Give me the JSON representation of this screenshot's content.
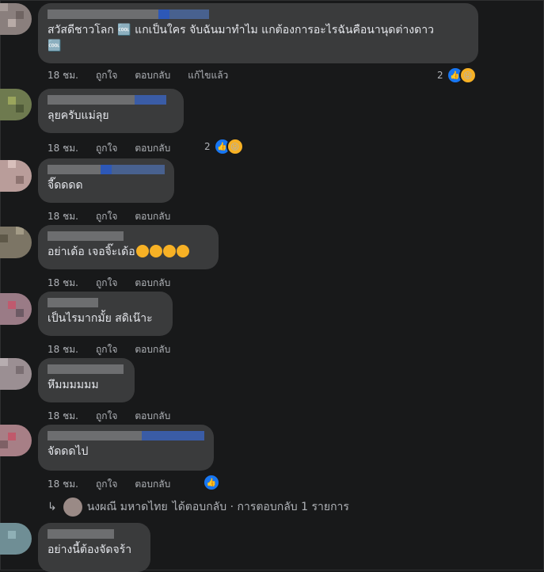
{
  "colors": {
    "background": "#18191a",
    "bubble": "#3a3b3c",
    "text": "#e4e6eb",
    "muted": "#b0b3b8",
    "like": "#1877f2",
    "haha": "#f7b125"
  },
  "actions": {
    "like": "ถูกใจ",
    "reply": "ตอบกลับ",
    "edited": "แก้ไขแล้ว"
  },
  "comments": [
    {
      "text": "สวัสดีชาวโลก 🆒 แกเป็นใคร จับฉันมาทำไม แกต้องการอะไรฉันคือนานุดต่างดาว",
      "text2": "🆒",
      "time": "18 ชม.",
      "reactions": "2"
    },
    {
      "text": "ลุยครับแม่ลุย",
      "time": "18 ชม.",
      "reactions": "2"
    },
    {
      "text": "จี๊ดดดด",
      "time": "18 ชม."
    },
    {
      "text": "อย่าเด้อ เจอจิ๊ะเด้อ",
      "time": "18 ชม."
    },
    {
      "text": "เป็นไรมากมั้ย สดิเน๊าะ",
      "time": "18 ชม."
    },
    {
      "text": "หึมมมมมม",
      "time": "18 ชม."
    },
    {
      "text": "จัดดดไป",
      "time": "18 ชม."
    },
    {
      "text": "อย่างนี้ต้องจัดจร้า"
    }
  ],
  "reply_summary": {
    "author": "นงผณี มหาดไทย",
    "text": "ได้ตอบกลับ · การตอบกลับ 1 รายการ"
  },
  "icons": {
    "like": "like-icon",
    "haha": "haha-icon",
    "reply_arrow": "reply-arrow-icon"
  }
}
